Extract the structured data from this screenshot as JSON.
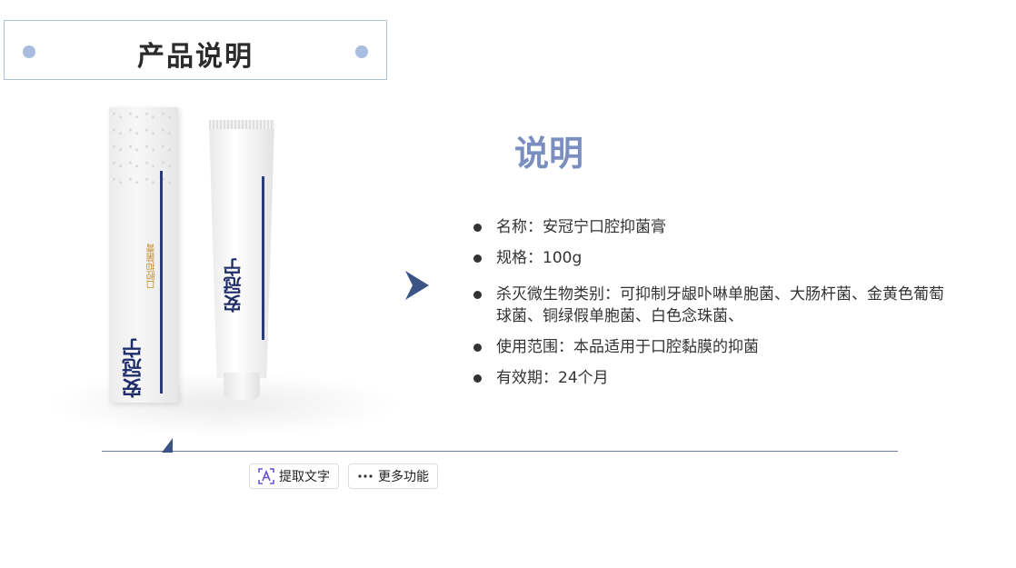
{
  "header": {
    "title": "产品说明"
  },
  "product_image": {
    "box_brand": "安冠宁",
    "box_subtitle": "口腔抑菌膏",
    "tube_brand": "安冠宁"
  },
  "section": {
    "heading": "说明",
    "items": [
      "名称：安冠宁口腔抑菌膏",
      "规格：100g",
      "杀灭微生物类别：可抑制牙龈卟啉单胞菌、大肠杆菌、金黄色葡萄球菌、铜绿假单胞菌、白色念珠菌、",
      "使用范围：本品适用于口腔黏膜的抑菌",
      "有效期：24个月"
    ]
  },
  "toolbar": {
    "extract_text_label": "提取文字",
    "more_label": "更多功能"
  },
  "colors": {
    "heading": "#7a8fc0",
    "accent_dark": "#3b5486",
    "title_dots": "#a9bde0"
  },
  "icons": [
    "text-extract-icon",
    "more-dots-icon",
    "play-arrow-icon"
  ]
}
